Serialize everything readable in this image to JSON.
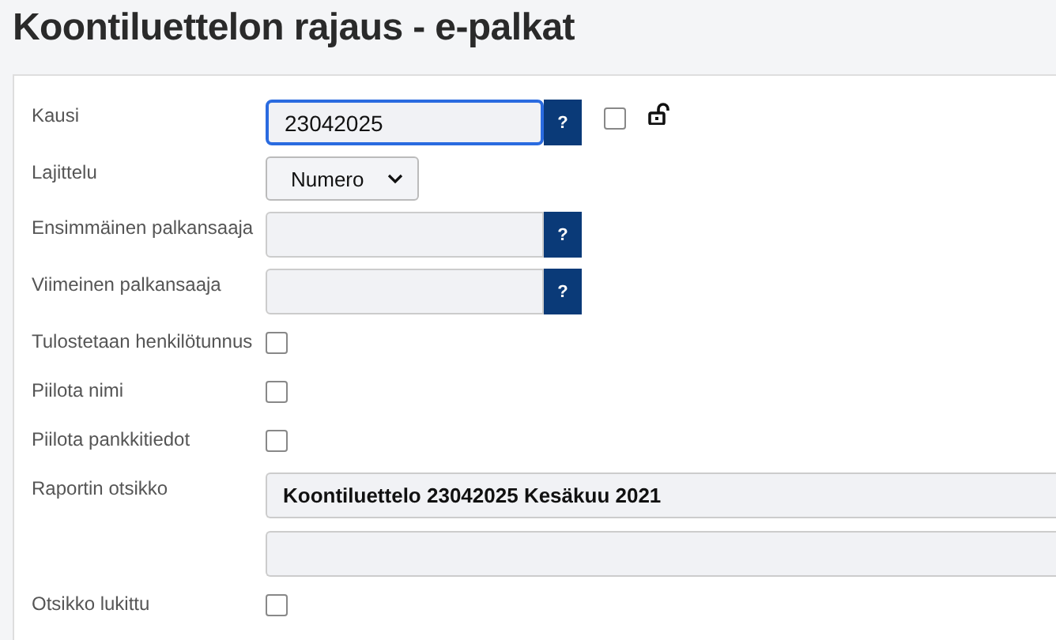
{
  "title": "Koontiluettelon rajaus - e-palkat",
  "fields": [
    {
      "kind": "lookup",
      "label": "Kausi",
      "value": "23042025",
      "focused": true,
      "help": "?",
      "extra": {
        "checked": false,
        "locked": false
      }
    },
    {
      "kind": "select",
      "label": "Lajittelu",
      "value": "Numero"
    },
    {
      "kind": "lookup",
      "label": "Ensimmäinen palkansaaja",
      "focused": false,
      "help": "?"
    },
    {
      "kind": "lookup",
      "label": "Viimeinen palkansaaja",
      "focused": false,
      "help": "?"
    },
    {
      "kind": "checkbox",
      "label": "Tulostetaan henkilötunnus",
      "checked": false
    },
    {
      "kind": "checkbox",
      "label": "Piilota nimi",
      "checked": false
    },
    {
      "kind": "checkbox",
      "label": "Piilota pankkitiedot",
      "checked": false
    },
    {
      "kind": "textpair",
      "label": "Raportin otsikko",
      "value": "Koontiluettelo 23042025 Kesäkuu 2021"
    },
    {
      "kind": "checkbox",
      "label": "Otsikko lukittu",
      "checked": false
    }
  ]
}
